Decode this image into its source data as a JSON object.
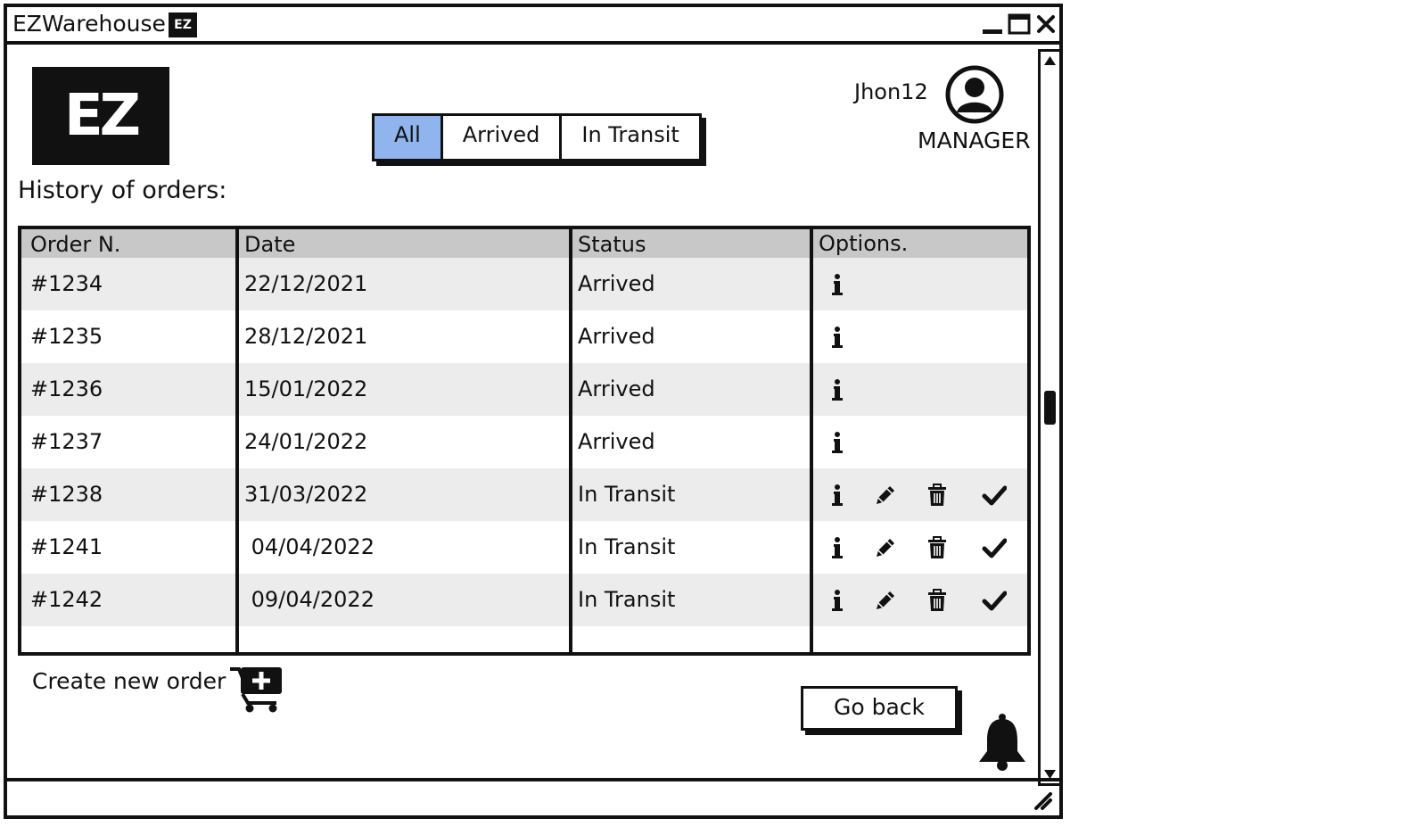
{
  "window": {
    "title": "EZWarehouse",
    "title_logo": "EZ"
  },
  "header": {
    "logo_text": "EZ",
    "filters": [
      "All",
      "Arrived",
      "In Transit"
    ],
    "active_filter": "All",
    "user": {
      "name": "Jhon12",
      "role": "MANAGER"
    }
  },
  "history": {
    "label": "History of orders:",
    "columns": [
      "Order N.",
      "Date",
      "Status",
      "Options."
    ],
    "rows": [
      {
        "order": "#1234",
        "date": "22/12/2021",
        "status": "Arrived",
        "options": [
          "info-icon"
        ]
      },
      {
        "order": "#1235",
        "date": "28/12/2021",
        "status": "Arrived",
        "options": [
          "info-icon"
        ]
      },
      {
        "order": "#1236",
        "date": "15/01/2022",
        "status": "Arrived",
        "options": [
          "info-icon"
        ]
      },
      {
        "order": "#1237",
        "date": "24/01/2022",
        "status": "Arrived",
        "options": [
          "info-icon"
        ]
      },
      {
        "order": "#1238",
        "date": "31/03/2022",
        "status": "In Transit",
        "options": [
          "info-icon",
          "pencil-icon",
          "trash-icon",
          "check-icon"
        ]
      },
      {
        "order": "#1241",
        "date": " 04/04/2022",
        "status": "In Transit",
        "options": [
          "info-icon",
          "pencil-icon",
          "trash-icon",
          "check-icon"
        ]
      },
      {
        "order": "#1242",
        "date": " 09/04/2022",
        "status": "In Transit",
        "options": [
          "info-icon",
          "pencil-icon",
          "trash-icon",
          "check-icon"
        ]
      }
    ]
  },
  "actions": {
    "create_order_label": "Create new order",
    "go_back_label": "Go back"
  },
  "colors": {
    "active_tab": "#8fb4ee",
    "header_row": "#c8c8c8",
    "alt_row": "#ececec",
    "ink": "#111111"
  }
}
